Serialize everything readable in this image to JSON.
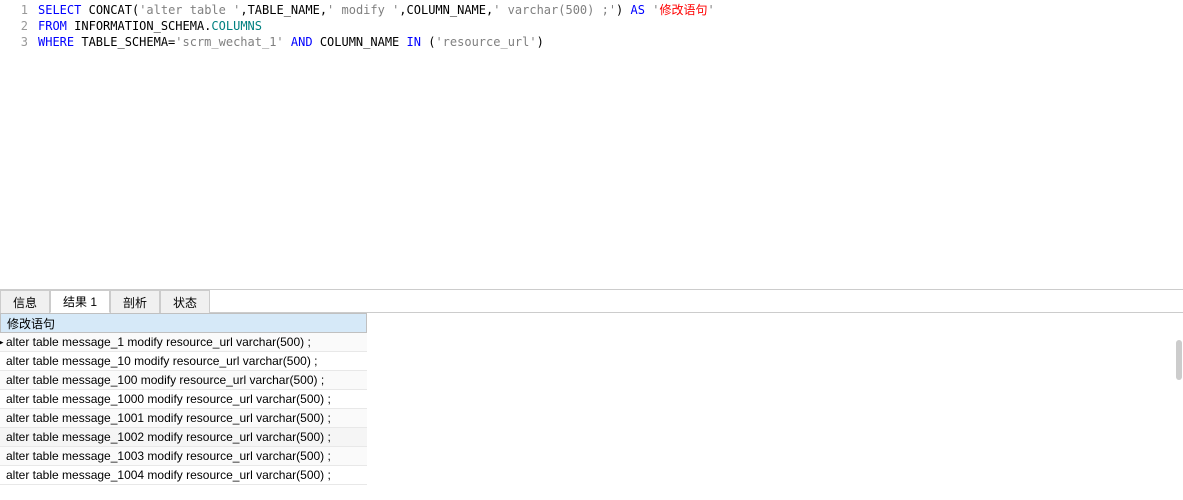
{
  "editor": {
    "lines": [
      {
        "num": "1"
      },
      {
        "num": "2"
      },
      {
        "num": "3"
      }
    ],
    "tokens": {
      "l1": {
        "select": "SELECT",
        "concat": "CONCAT",
        "op": "(",
        "s1": "'alter table '",
        "c1": ",TABLE_NAME,",
        "s2": "' modify '",
        "c2": ",COLUMN_NAME,",
        "s3": "' varchar(500) ;'",
        "cp": ")",
        "as": "AS",
        "alias_q1": "'",
        "alias": "修改语句",
        "alias_q2": "'"
      },
      "l2": {
        "from": "FROM",
        "schema": "INFORMATION_SCHEMA.",
        "cols": "COLUMNS"
      },
      "l3": {
        "where": "WHERE",
        "ts": "TABLE_SCHEMA=",
        "v1": "'scrm_wechat_1'",
        "and": "AND",
        "cn": "COLUMN_NAME",
        "in": "IN",
        "op": "(",
        "v2": "'resource_url'",
        "cp": ")"
      }
    }
  },
  "tabs": [
    {
      "label": "信息",
      "active": false
    },
    {
      "label": "结果 1",
      "active": true
    },
    {
      "label": "剖析",
      "active": false
    },
    {
      "label": "状态",
      "active": false
    }
  ],
  "results": {
    "header": "修改语句",
    "rows": [
      "alter table message_1 modify resource_url varchar(500) ;",
      "alter table message_10 modify resource_url varchar(500) ;",
      "alter table message_100 modify resource_url varchar(500) ;",
      "alter table message_1000 modify resource_url varchar(500) ;",
      "alter table message_1001 modify resource_url varchar(500) ;",
      "alter table message_1002 modify resource_url varchar(500) ;",
      "alter table message_1003 modify resource_url varchar(500) ;",
      "alter table message_1004 modify resource_url varchar(500) ;"
    ]
  }
}
